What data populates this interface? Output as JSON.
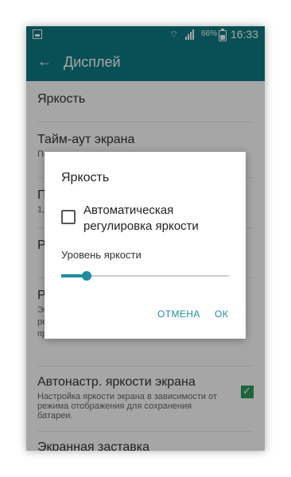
{
  "status": {
    "battery": "66%",
    "time": "16:33"
  },
  "appbar": {
    "title": "Дисплей",
    "back_icon": "arrow-left"
  },
  "settings": {
    "items": [
      {
        "title": "Яркость",
        "subtitle": ""
      },
      {
        "title": "Тайм-аут экрана",
        "subtitle": "Пе"
      },
      {
        "title": "П",
        "subtitle": "1,"
      },
      {
        "title": "Р",
        "subtitle": ""
      },
      {
        "title": "Р",
        "subtitle": "Эк"
      },
      {
        "title": "Автонастр. яркости экрана",
        "subtitle": "Настройка яркости экрана в зависимости от режима отображения для сохранения батареи."
      },
      {
        "title": "Экранная заставка",
        "subtitle": ""
      }
    ],
    "row5_subtitle_lines": [
      "Эк",
      "ре",
      "пр"
    ]
  },
  "dialog": {
    "title": "Яркость",
    "auto_label": "Автоматическая регулировка яркости",
    "level_label": "Уровень яркости",
    "slider_value": 0.15,
    "cancel": "ОТМЕНА",
    "ok": "ОК"
  }
}
